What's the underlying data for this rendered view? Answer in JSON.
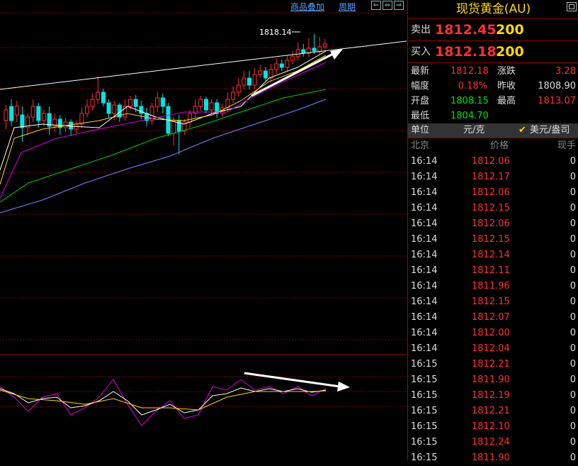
{
  "toolbar": {
    "overlay_label": "商品叠加",
    "period_label": "周期",
    "btn_left": "⇐",
    "btn_swap": "⇔",
    "btn_right": "⇒"
  },
  "chart": {
    "annotation_high": "1818.14"
  },
  "panel": {
    "title": "现货黄金(AU)",
    "sell_label": "卖出",
    "sell_price": "1812.45",
    "sell_volume": "200",
    "buy_label": "买入",
    "buy_price": "1812.18",
    "buy_volume": "200",
    "stats": {
      "latest_label": "最新",
      "latest": "1812.18",
      "change_label": "涨跌",
      "change": "3.28",
      "pct_label": "幅度",
      "pct": "0.18%",
      "prev_close_label": "昨收",
      "prev_close": "1808.90",
      "open_label": "开盘",
      "open": "1808.15",
      "high_label": "最高",
      "high": "1813.07",
      "low_label": "最低",
      "low": "1804.70"
    },
    "unit_label": "单位",
    "unit_value": "元/克",
    "unit_option": "美元/盎司",
    "columns": [
      "北京",
      "价格",
      "现手"
    ],
    "ticks": [
      [
        "16:14",
        "1812.06",
        "0"
      ],
      [
        "16:14",
        "1812.17",
        "0"
      ],
      [
        "16:14",
        "1812.06",
        "0"
      ],
      [
        "16:14",
        "1812.15",
        "0"
      ],
      [
        "16:14",
        "1812.06",
        "0"
      ],
      [
        "16:14",
        "1812.15",
        "0"
      ],
      [
        "16:14",
        "1812.14",
        "0"
      ],
      [
        "16:14",
        "1812.11",
        "0"
      ],
      [
        "16:14",
        "1811.96",
        "0"
      ],
      [
        "16:14",
        "1812.15",
        "0"
      ],
      [
        "16:14",
        "1812.07",
        "0"
      ],
      [
        "16:14",
        "1812.00",
        "0"
      ],
      [
        "16:14",
        "1812.04",
        "0"
      ],
      [
        "16:15",
        "1812.21",
        "0"
      ],
      [
        "16:15",
        "1811.90",
        "0"
      ],
      [
        "16:15",
        "1812.19",
        "0"
      ],
      [
        "16:15",
        "1812.21",
        "0"
      ],
      [
        "16:15",
        "1812.10",
        "0"
      ],
      [
        "16:15",
        "1812.24",
        "0"
      ],
      [
        "16:15",
        "1811.90",
        "0"
      ]
    ]
  },
  "colors": {
    "up": "#ff3030",
    "down": "#00e5e5",
    "green": "#00e000",
    "yellow": "#ffd800"
  }
}
